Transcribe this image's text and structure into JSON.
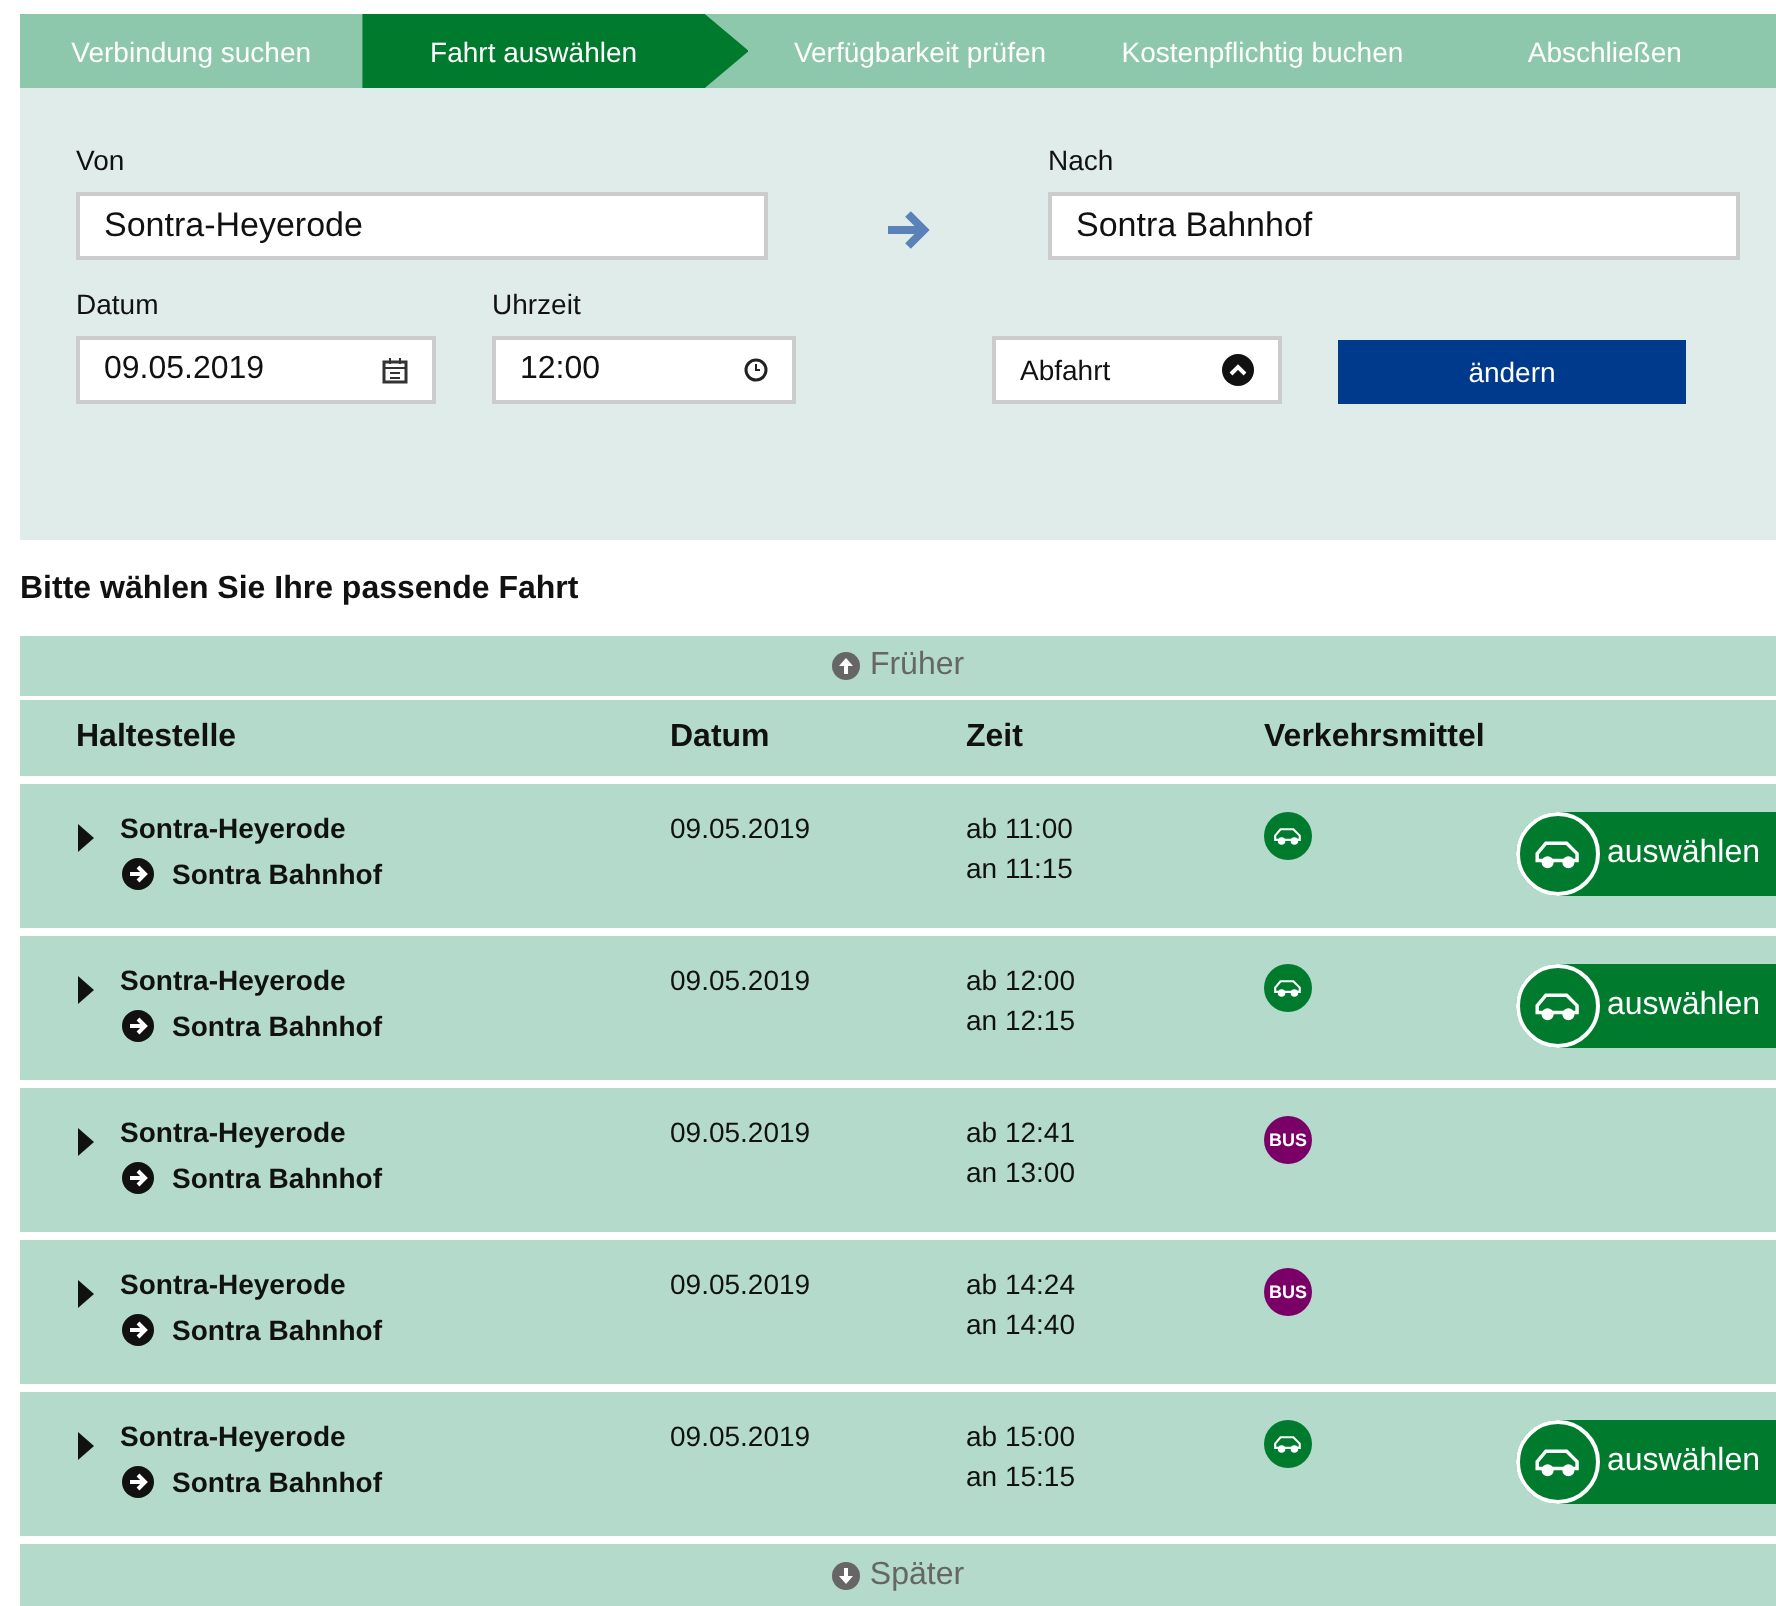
{
  "steps": [
    {
      "label": "Verbindung suchen",
      "selected": false
    },
    {
      "label": "Fahrt auswählen",
      "selected": true
    },
    {
      "label": "Verfügbarkeit prüfen",
      "selected": false
    },
    {
      "label": "Kostenpflichtig buchen",
      "selected": false
    },
    {
      "label": "Abschließen",
      "selected": false
    }
  ],
  "form": {
    "from_label": "Von",
    "from_value": "Sontra-Heyerode",
    "to_label": "Nach",
    "to_value": "Sontra Bahnhof",
    "date_label": "Datum",
    "date_value": "09.05.2019",
    "time_label": "Uhrzeit",
    "time_value": "12:00",
    "mode_value": "Abfahrt",
    "submit": "ändern"
  },
  "heading": "Bitte wählen Sie Ihre passende Fahrt",
  "earlier": "Früher",
  "table": {
    "columns": [
      "Haltestelle",
      "Datum",
      "Zeit",
      "Verkehrsmittel"
    ],
    "rows": [
      {
        "from": "Sontra-Heyerode",
        "to": "Sontra Bahnhof",
        "date": "09.05.2019",
        "dep": "ab 11:00",
        "arr": "an 11:15",
        "kind": "car",
        "select": "auswählen"
      },
      {
        "from": "Sontra-Heyerode",
        "to": "Sontra Bahnhof",
        "date": "09.05.2019",
        "dep": "ab 12:00",
        "arr": "an 12:15",
        "kind": "car",
        "select": "auswählen"
      },
      {
        "from": "Sontra-Heyerode",
        "to": "Sontra Bahnhof",
        "date": "09.05.2019",
        "dep": "ab 12:41",
        "arr": "an 13:00",
        "kind": "bus",
        "badge": "BUS"
      },
      {
        "from": "Sontra-Heyerode",
        "to": "Sontra Bahnhof",
        "date": "09.05.2019",
        "dep": "ab 14:24",
        "arr": "an 14:40",
        "kind": "bus",
        "badge": "BUS"
      },
      {
        "from": "Sontra-Heyerode",
        "to": "Sontra Bahnhof",
        "date": "09.05.2019",
        "dep": "ab 15:00",
        "arr": "an 15:15",
        "kind": "car",
        "select": "auswählen"
      }
    ]
  },
  "later": "Später"
}
